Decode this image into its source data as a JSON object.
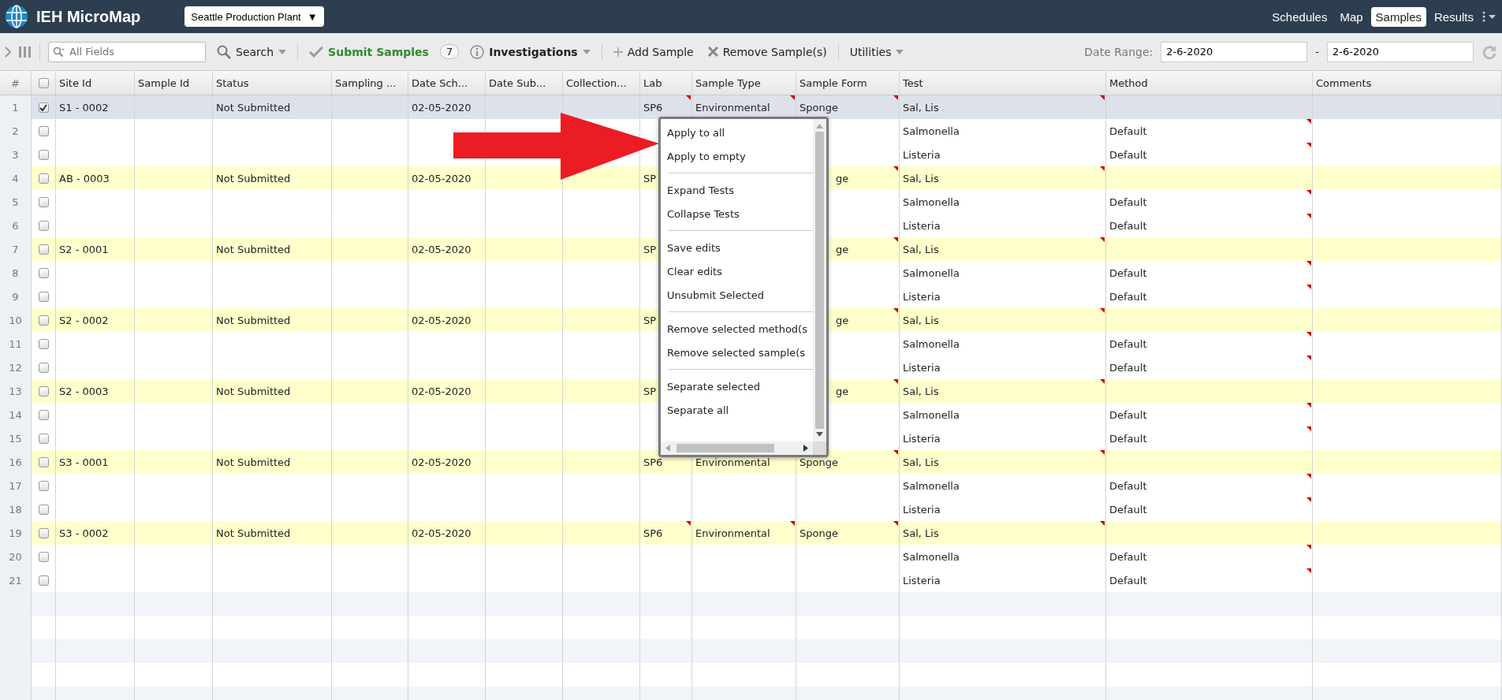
{
  "app": {
    "title": "IEH MicroMap"
  },
  "plant_selector": {
    "value": "Seattle Production Plant",
    "caret": "▼"
  },
  "nav": [
    {
      "label": "Schedules",
      "selected": false
    },
    {
      "label": "Map",
      "selected": false
    },
    {
      "label": "Samples",
      "selected": true
    },
    {
      "label": "Results",
      "selected": false
    }
  ],
  "toolbar": {
    "search_placeholder": "All Fields",
    "search": "Search",
    "submit": "Submit Samples",
    "submit_count": "7",
    "investigations": "Investigations",
    "add": "Add Sample",
    "remove": "Remove Sample(s)",
    "utilities": "Utilities",
    "date_range_label": "Date Range:",
    "date_from": "2-6-2020",
    "date_separator": "-",
    "date_to": "2-6-2020"
  },
  "table": {
    "header_checked": false,
    "columns": [
      "#",
      "Site Id",
      "Sample Id",
      "Status",
      "Sampling ...",
      "Date Sch...",
      "Date Sub...",
      "Collection...",
      "Lab",
      "Sample Type",
      "Sample Form",
      "Test",
      "Method",
      "Comments"
    ],
    "rows": [
      {
        "number": "1",
        "kind": "sample",
        "selected": true,
        "checked": true,
        "covered": false,
        "site_id": "S1 - 0002",
        "status": "Not Submitted",
        "date_scheduled": "02-05-2020",
        "lab": "SP6",
        "sample_type": "Environmental",
        "sample_form": "Sponge",
        "test": "Sal, Lis"
      },
      {
        "number": "2",
        "kind": "test",
        "selected": false,
        "checked": false,
        "covered": false,
        "test": "Salmonella",
        "method": "Default"
      },
      {
        "number": "3",
        "kind": "test",
        "selected": false,
        "checked": false,
        "covered": false,
        "test": "Listeria",
        "method": "Default"
      },
      {
        "number": "4",
        "kind": "sample",
        "selected": false,
        "checked": false,
        "covered": true,
        "site_id": "AB - 0003",
        "status": "Not Submitted",
        "date_scheduled": "02-05-2020",
        "lab": "SP",
        "sample_form": "ge",
        "test": "Sal, Lis"
      },
      {
        "number": "5",
        "kind": "test",
        "selected": false,
        "checked": false,
        "covered": false,
        "test": "Salmonella",
        "method": "Default"
      },
      {
        "number": "6",
        "kind": "test",
        "selected": false,
        "checked": false,
        "covered": false,
        "test": "Listeria",
        "method": "Default"
      },
      {
        "number": "7",
        "kind": "sample",
        "selected": false,
        "checked": false,
        "covered": true,
        "site_id": "S2 - 0001",
        "status": "Not Submitted",
        "date_scheduled": "02-05-2020",
        "lab": "SP",
        "sample_form": "ge",
        "test": "Sal, Lis"
      },
      {
        "number": "8",
        "kind": "test",
        "selected": false,
        "checked": false,
        "covered": false,
        "test": "Salmonella",
        "method": "Default"
      },
      {
        "number": "9",
        "kind": "test",
        "selected": false,
        "checked": false,
        "covered": false,
        "test": "Listeria",
        "method": "Default"
      },
      {
        "number": "10",
        "kind": "sample",
        "selected": false,
        "checked": false,
        "covered": true,
        "site_id": "S2 - 0002",
        "status": "Not Submitted",
        "date_scheduled": "02-05-2020",
        "lab": "SP",
        "sample_form": "ge",
        "test": "Sal, Lis"
      },
      {
        "number": "11",
        "kind": "test",
        "selected": false,
        "checked": false,
        "covered": false,
        "test": "Salmonella",
        "method": "Default"
      },
      {
        "number": "12",
        "kind": "test",
        "selected": false,
        "checked": false,
        "covered": false,
        "test": "Listeria",
        "method": "Default"
      },
      {
        "number": "13",
        "kind": "sample",
        "selected": false,
        "checked": false,
        "covered": true,
        "site_id": "S2 - 0003",
        "status": "Not Submitted",
        "date_scheduled": "02-05-2020",
        "lab": "SP",
        "sample_form": "ge",
        "test": "Sal, Lis"
      },
      {
        "number": "14",
        "kind": "test",
        "selected": false,
        "checked": false,
        "covered": false,
        "test": "Salmonella",
        "method": "Default"
      },
      {
        "number": "15",
        "kind": "test",
        "selected": false,
        "checked": false,
        "covered": false,
        "test": "Listeria",
        "method": "Default"
      },
      {
        "number": "16",
        "kind": "sample",
        "selected": false,
        "checked": false,
        "covered": false,
        "site_id": "S3 - 0001",
        "status": "Not Submitted",
        "date_scheduled": "02-05-2020",
        "lab": "SP6",
        "sample_type": "Environmental",
        "sample_form": "Sponge",
        "test": "Sal, Lis"
      },
      {
        "number": "17",
        "kind": "test",
        "selected": false,
        "checked": false,
        "covered": false,
        "test": "Salmonella",
        "method": "Default"
      },
      {
        "number": "18",
        "kind": "test",
        "selected": false,
        "checked": false,
        "covered": false,
        "test": "Listeria",
        "method": "Default"
      },
      {
        "number": "19",
        "kind": "sample",
        "selected": false,
        "checked": false,
        "covered": false,
        "site_id": "S3 - 0002",
        "status": "Not Submitted",
        "date_scheduled": "02-05-2020",
        "lab": "SP6",
        "sample_type": "Environmental",
        "sample_form": "Sponge",
        "test": "Sal, Lis"
      },
      {
        "number": "20",
        "kind": "test",
        "selected": false,
        "checked": false,
        "covered": false,
        "test": "Salmonella",
        "method": "Default"
      },
      {
        "number": "21",
        "kind": "test",
        "selected": false,
        "checked": false,
        "covered": false,
        "test": "Listeria",
        "method": "Default"
      }
    ]
  },
  "context_menu": {
    "groups": [
      [
        "Apply to all",
        "Apply to empty"
      ],
      [
        "Expand Tests",
        "Collapse Tests"
      ],
      [
        "Save edits",
        "Clear edits",
        "Unsubmit Selected"
      ],
      [
        "Remove selected method(s",
        "Remove selected sample(s"
      ],
      [
        "Separate selected",
        "Separate all"
      ]
    ]
  }
}
